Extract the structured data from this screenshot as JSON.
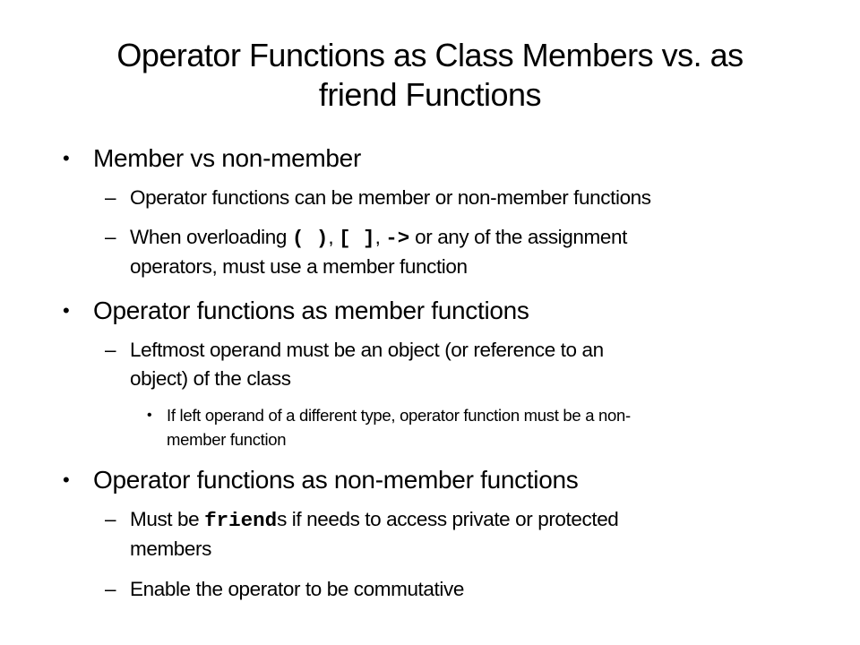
{
  "slide": {
    "title_line1": "Operator Functions as Class Members vs. as",
    "title_line2": "friend Functions",
    "bullets": [
      {
        "text": "Member vs non-member",
        "subs": [
          {
            "text": "Operator functions can be member or non-member functions"
          },
          {
            "prefix": "When overloading ",
            "code1": "( )",
            "sep1": ", ",
            "code2": "[ ]",
            "sep2": ", ",
            "code3": "->",
            "suffix": " or any of the assignment",
            "line2": "operators, must use a member function"
          }
        ]
      },
      {
        "text": "Operator functions as member functions",
        "subs": [
          {
            "text": "Leftmost operand must be an object (or reference to an",
            "line2": "object) of the class",
            "subs": [
              {
                "text": "If left operand of a different type, operator function must be a non-",
                "line2": "member function"
              }
            ]
          }
        ]
      },
      {
        "text": "Operator functions as non-member functions",
        "subs": [
          {
            "prefix": "Must be ",
            "code": "friend",
            "suffix": "s if needs to access private or protected",
            "line2": "members"
          },
          {
            "text": "Enable the operator to be commutative"
          }
        ]
      }
    ]
  },
  "markers": {
    "bullet": "•",
    "dash": "–",
    "small_bullet": "•"
  }
}
